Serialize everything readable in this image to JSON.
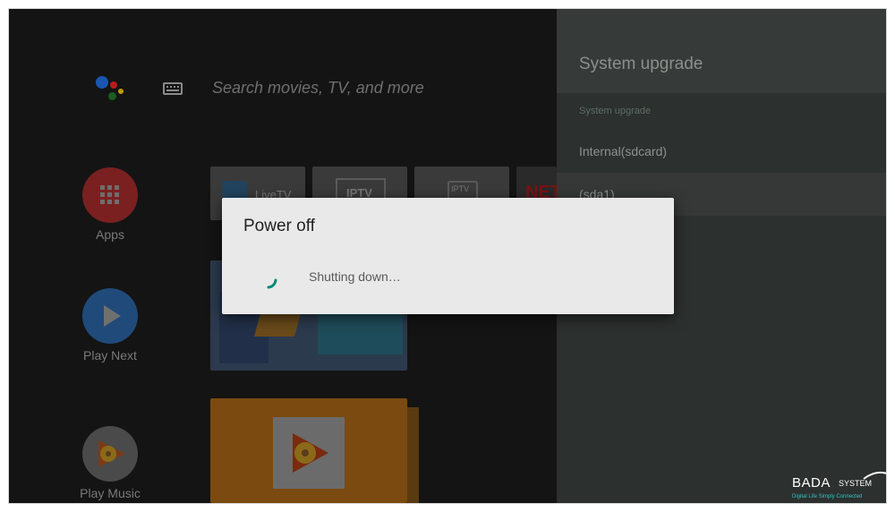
{
  "search": {
    "placeholder": "Search movies, TV, and more"
  },
  "nav": {
    "apps_label": "Apps",
    "play_next_label": "Play Next",
    "play_music_label": "Play Music"
  },
  "tiles": {
    "live_tv": "LiveTV",
    "iptv": "IPTV",
    "iptv2": "IPTV",
    "netflix": "NET"
  },
  "panel": {
    "title": "System upgrade",
    "section": "System upgrade",
    "items": [
      {
        "label": "Internal(sdcard)"
      },
      {
        "label": "(sda1)"
      }
    ]
  },
  "dialog": {
    "title": "Power off",
    "message": "Shutting down…"
  },
  "colors": {
    "apps_red": "#c62828",
    "play_next_blue": "#2f7bd9",
    "spinner_green": "#00897b",
    "music_orange": "#f57c00"
  },
  "logo": {
    "main": "BADA",
    "sub": "SYSTEM",
    "tagline": "Digital Life Simply Connected"
  }
}
